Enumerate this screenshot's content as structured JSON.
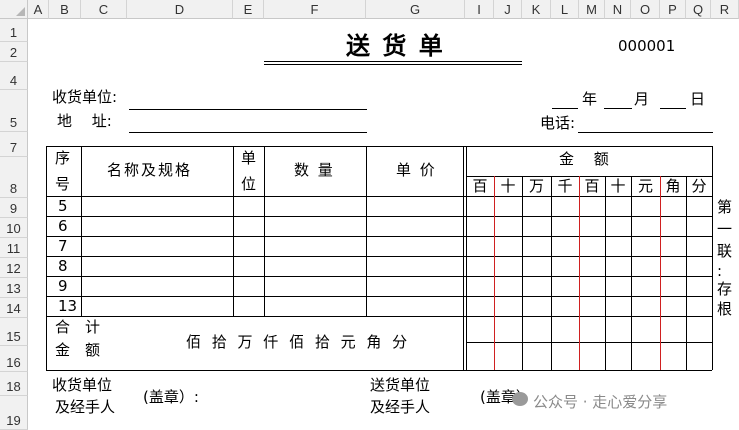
{
  "sheet": {
    "columns": [
      "A",
      "B",
      "C",
      "D",
      "E",
      "F",
      "G",
      "I",
      "J",
      "K",
      "L",
      "M",
      "N",
      "O",
      "P",
      "Q",
      "R"
    ],
    "rows": [
      "1",
      "2",
      "4",
      "5",
      "7",
      "8",
      "9",
      "10",
      "11",
      "12",
      "13",
      "14",
      "15",
      "16",
      "18",
      "19"
    ]
  },
  "doc": {
    "title": "送 货 单",
    "number": "000001",
    "receiver_label": "收货单位:",
    "address_label": "地　 址:",
    "year": "年",
    "month": "月",
    "day": "日",
    "phone_label": "电话:"
  },
  "table": {
    "seq_top": "序",
    "seq_bottom": "号",
    "name_header": "名称及规格",
    "unit_top": "单",
    "unit_bottom": "位",
    "qty_header": "数 量",
    "price_header": "单 价",
    "amount_header": "金　 额",
    "digits": [
      "百",
      "十",
      "万",
      "千",
      "百",
      "十",
      "元",
      "角",
      "分"
    ],
    "seq_values": [
      "5",
      "6",
      "7",
      "8",
      "9",
      "13"
    ],
    "total_top": "合　计",
    "total_bottom": "金　额",
    "total_units": "佰 拾 万 仟 佰 拾 元 角 分"
  },
  "side_note": [
    "第",
    "一",
    "联",
    ":",
    "存",
    "根"
  ],
  "footer": {
    "recv_top": "收货单位",
    "recv_bottom": "及经手人",
    "seal1": "(盖章）:",
    "send_top": "送货单位",
    "send_bottom": "及经手人",
    "seal2": "(盖章）",
    "watermark": "公众号 · 走心爱分享"
  },
  "colors": {
    "grid_header_bg": "#f1f1f1",
    "red_divider": "#d02020"
  }
}
